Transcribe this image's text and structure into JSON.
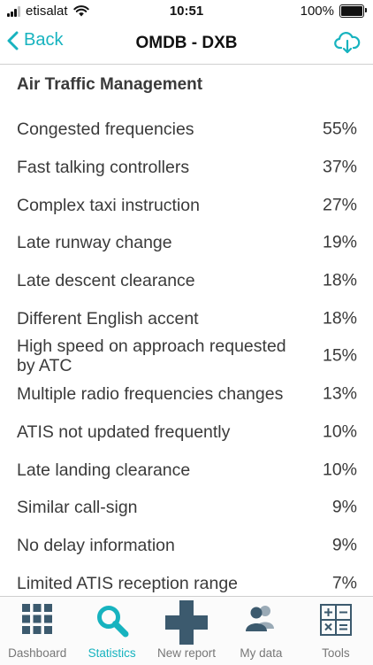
{
  "status_bar": {
    "carrier": "etisalat",
    "time": "10:51",
    "battery": "100%"
  },
  "nav": {
    "back_label": "Back",
    "title": "OMDB - DXB"
  },
  "section": {
    "title": "Air Traffic Management",
    "rows": [
      {
        "label": "Congested frequencies",
        "value": "55%"
      },
      {
        "label": "Fast talking controllers",
        "value": "37%"
      },
      {
        "label": "Complex taxi instruction",
        "value": "27%"
      },
      {
        "label": "Late runway change",
        "value": "19%"
      },
      {
        "label": "Late descent clearance",
        "value": "18%"
      },
      {
        "label": "Different English accent",
        "value": "18%"
      },
      {
        "label": "High speed on approach requested by ATC",
        "value": "15%"
      },
      {
        "label": "Multiple radio frequencies changes",
        "value": "13%"
      },
      {
        "label": "ATIS not updated frequently",
        "value": "10%"
      },
      {
        "label": "Late landing clearance",
        "value": "10%"
      },
      {
        "label": "Similar call-sign",
        "value": "9%"
      },
      {
        "label": "No delay information",
        "value": "9%"
      },
      {
        "label": "Limited ATIS reception range",
        "value": "7%"
      }
    ]
  },
  "tabs": [
    {
      "label": "Dashboard",
      "icon": "grid-icon"
    },
    {
      "label": "Statistics",
      "icon": "magnifier-icon"
    },
    {
      "label": "New report",
      "icon": "plus-icon"
    },
    {
      "label": "My data",
      "icon": "people-icon"
    },
    {
      "label": "Tools",
      "icon": "calculator-icon"
    }
  ],
  "colors": {
    "accent": "#17b3bf",
    "icon_dark": "#3c5a6e",
    "text": "#3a3a3a"
  }
}
